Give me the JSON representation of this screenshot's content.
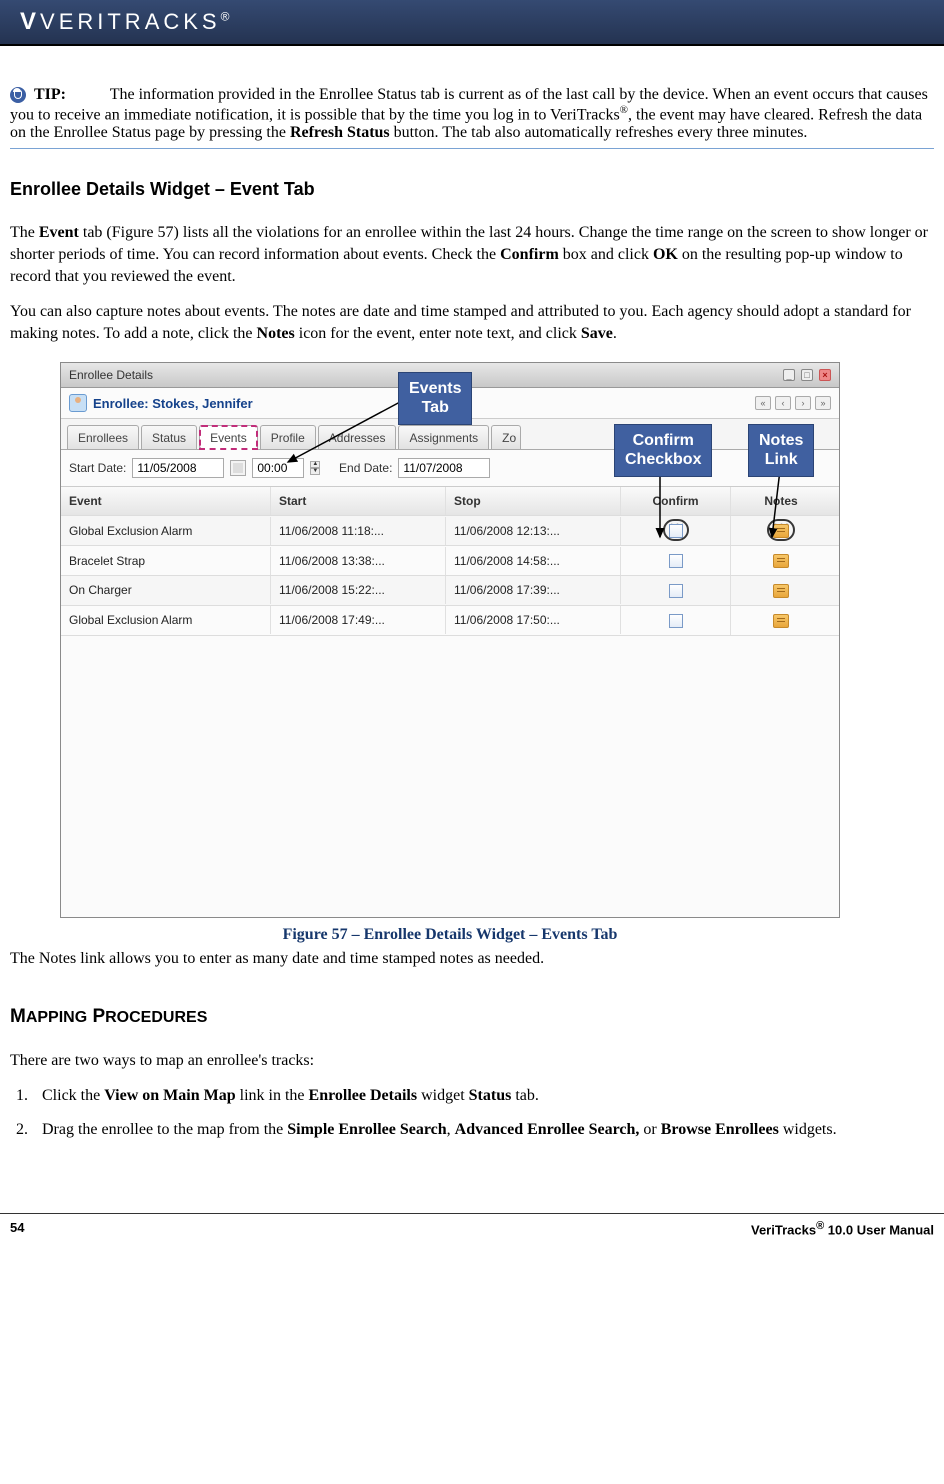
{
  "logo": "VERITRACKS",
  "logo_reg": "®",
  "tip": {
    "label": "TIP:",
    "text_before": "The information provided in the Enrollee Status tab is current as of the last call by the device. When an event occurs that causes you to receive an immediate notification, it is possible that by the time you log in to VeriTracks",
    "text_after": ", the event may have cleared. Refresh the data on the Enrollee Status page by pressing the ",
    "bold1": "Refresh Status",
    "text_end": " button.  The tab also automatically refreshes every three minutes."
  },
  "heading1": "Enrollee Details Widget – Event Tab",
  "para1_a": "The ",
  "para1_b": "Event",
  "para1_c": " tab (Figure 57) lists all the violations for an enrollee within the last 24 hours. Change the time range on the screen to show longer or shorter periods of time. You can record information about events. Check the ",
  "para1_d": "Confirm",
  "para1_e": " box and click ",
  "para1_f": "OK",
  "para1_g": " on the resulting pop-up window to record that you reviewed the event.",
  "para2_a": "You can also capture notes about events. The notes are date and time stamped and attributed to you. Each agency should adopt a standard for making notes. To add a note, click the ",
  "para2_b": "Notes",
  "para2_c": " icon for the event, enter note text, and click ",
  "para2_d": "Save",
  "para2_e": ".",
  "widget": {
    "title": "Enrollee Details",
    "enrollee_label": "Enrollee: Stokes, Jennifer",
    "tabs": [
      "Enrollees",
      "Status",
      "Events",
      "Profile",
      "Addresses",
      "Assignments",
      "Zo"
    ],
    "start_label": "Start Date:",
    "start_val": "11/05/2008",
    "time_val": "00:00",
    "end_label": "End Date:",
    "end_val": "11/07/2008",
    "headers": {
      "event": "Event",
      "start": "Start",
      "stop": "Stop",
      "confirm": "Confirm",
      "notes": "Notes"
    },
    "rows": [
      {
        "event": "Global Exclusion Alarm",
        "start": "11/06/2008 11:18:...",
        "stop": "11/06/2008 12:13:..."
      },
      {
        "event": "Bracelet Strap",
        "start": "11/06/2008 13:38:...",
        "stop": "11/06/2008 14:58:..."
      },
      {
        "event": "On Charger",
        "start": "11/06/2008 15:22:...",
        "stop": "11/06/2008 17:39:..."
      },
      {
        "event": "Global Exclusion Alarm",
        "start": "11/06/2008 17:49:...",
        "stop": "11/06/2008 17:50:..."
      }
    ]
  },
  "callouts": {
    "events": "Events\nTab",
    "confirm": "Confirm\nCheckbox",
    "notes": "Notes\nLink"
  },
  "figure_caption": "Figure 57 – Enrollee Details Widget – Events Tab",
  "para3": "The Notes link allows you to enter as many date and time stamped notes as needed.",
  "heading2_a": "M",
  "heading2_b": "APPING",
  "heading2_c": " P",
  "heading2_d": "ROCEDURES",
  "map_intro": "There are two ways to map an enrollee's tracks:",
  "li1_a": "Click the ",
  "li1_b": "View on Main Map",
  "li1_c": " link in the ",
  "li1_d": "Enrollee Details",
  "li1_e": " widget ",
  "li1_f": "Status",
  "li1_g": " tab.",
  "li2_a": "Drag the enrollee to the map from the ",
  "li2_b": "Simple Enrollee Search",
  "li2_c": ", ",
  "li2_d": "Advanced Enrollee Search,",
  "li2_e": " or ",
  "li2_f": "Browse Enrollees",
  "li2_g": " widgets.",
  "footer": {
    "page": "54",
    "manual_a": "VeriTracks",
    "manual_b": " 10.0 User Manual"
  }
}
